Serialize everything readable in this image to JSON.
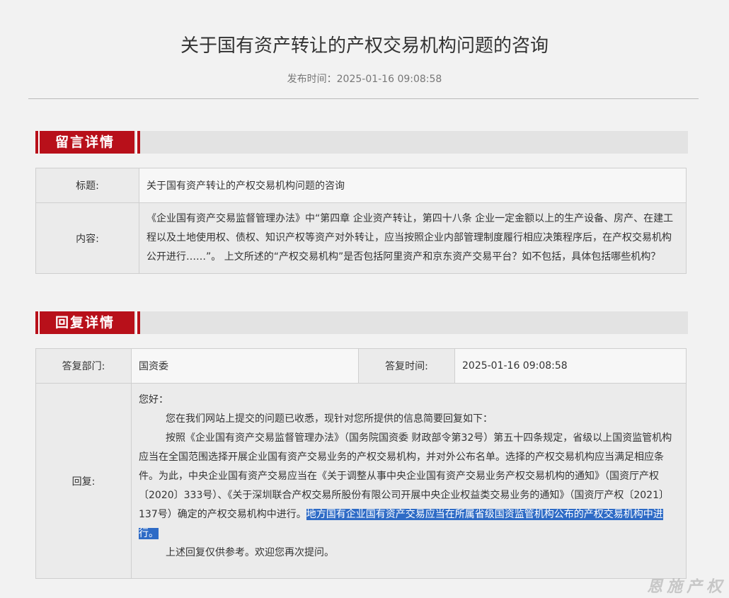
{
  "header": {
    "title": "关于国有资产转让的产权交易机构问题的咨询",
    "publish_time": "发布时间：2025-01-16 09:08:58"
  },
  "message": {
    "section_label": "留言详情",
    "title_label": "标题:",
    "title_value": "关于国有资产转让的产权交易机构问题的咨询",
    "content_label": "内容:",
    "content_value": "《企业国有资产交易监督管理办法》中“第四章 企业资产转让，第四十八条 企业一定金额以上的生产设备、房产、在建工程以及土地使用权、债权、知识产权等资产对外转让，应当按照企业内部管理制度履行相应决策程序后，在产权交易机构公开进行……”。 上文所述的“产权交易机构”是否包括阿里资产和京东资产交易平台？如不包括，具体包括哪些机构？"
  },
  "reply": {
    "section_label": "回复详情",
    "dept_label": "答复部门:",
    "dept_value": "国资委",
    "time_label": "答复时间:",
    "time_value": "2025-01-16 09:08:58",
    "reply_label": "回复:",
    "greeting": "您好：",
    "para1": "您在我们网站上提交的问题已收悉，现针对您所提供的信息简要回复如下：",
    "para2_main": "按照《企业国有资产交易监督管理办法》（国务院国资委 财政部令第32号）第五十四条规定，省级以上国资监管机构应当在全国范围选择开展企业国有资产交易业务的产权交易机构，并对外公布名单。选择的产权交易机构应当满足相应条件。为此，中央企业国有资产交易应当在《关于调整从事中央企业国有资产交易业务产权交易机构的通知》（国资厅产权〔2020〕333号）、《关于深圳联合产权交易所股份有限公司开展中央企业权益类交易业务的通知》（国资厅产权〔2021〕137号）确定的产权交易机构中进行。",
    "para2_highlight": "地方国有企业国有资产交易应当在所属省级国资监管机构公布的产权交易机构中进行。",
    "para3": "上述回复仅供参考。欢迎您再次提问。"
  },
  "watermark": "恩施产权"
}
